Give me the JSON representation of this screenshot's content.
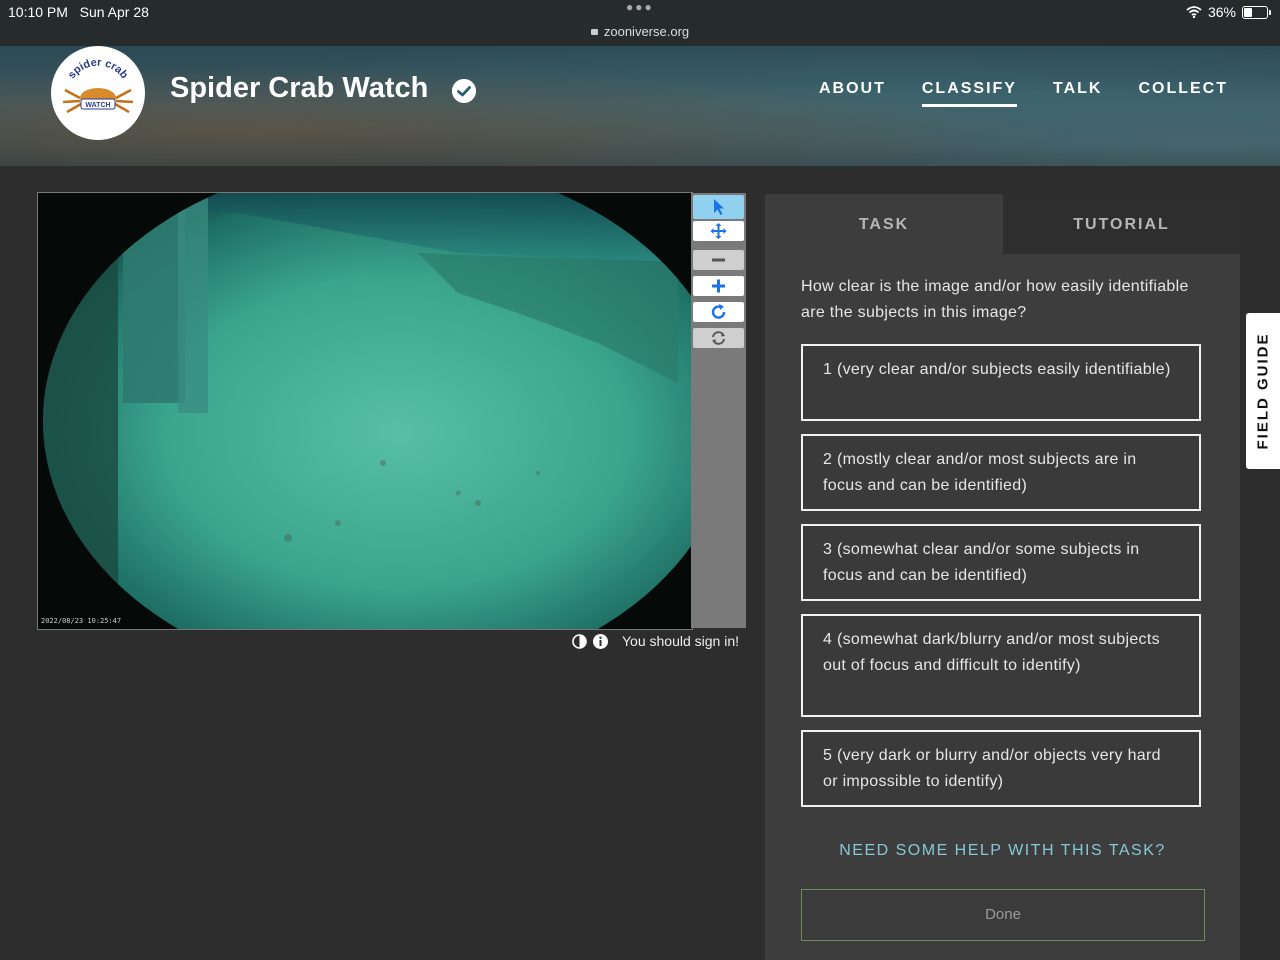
{
  "status_bar": {
    "time": "10:10 PM",
    "date": "Sun Apr 28",
    "url": "zooniverse.org",
    "battery": "36%"
  },
  "header": {
    "logo_text_top": "spider crab",
    "logo_text_bottom": "WATCH",
    "title": "Spider Crab Watch",
    "nav": {
      "about": "ABOUT",
      "classify": "CLASSIFY",
      "talk": "TALK",
      "collect": "COLLECT"
    }
  },
  "subject": {
    "timestamp": "2022/08/23 10:25:47",
    "sign_in_text": "You should sign in!"
  },
  "task": {
    "tab_task": "TASK",
    "tab_tutorial": "TUTORIAL",
    "question": "How clear is the image and/or how easily identifiable are the subjects in this image?",
    "answers": [
      "1 (very clear and/or subjects easily identifiable)",
      "2 (mostly clear and/or most subjects are in focus and can be identified)",
      "3 (somewhat clear and/or some subjects in focus and can be identified)",
      "4 (somewhat dark/blurry and/or most subjects out of focus and difficult to identify)",
      "5 (very dark or blurry and/or objects very hard or impossible to identify)"
    ],
    "help_link": "NEED SOME HELP WITH THIS TASK?",
    "done_label": "Done"
  },
  "field_guide": "FIELD GUIDE",
  "colors": {
    "page_bg": "#2d2d2d",
    "panel_bg": "#3d3d3d",
    "help_link": "#86c9d6",
    "tool_selected": "#8fd1ef",
    "tool_icon": "#1a73e8"
  }
}
